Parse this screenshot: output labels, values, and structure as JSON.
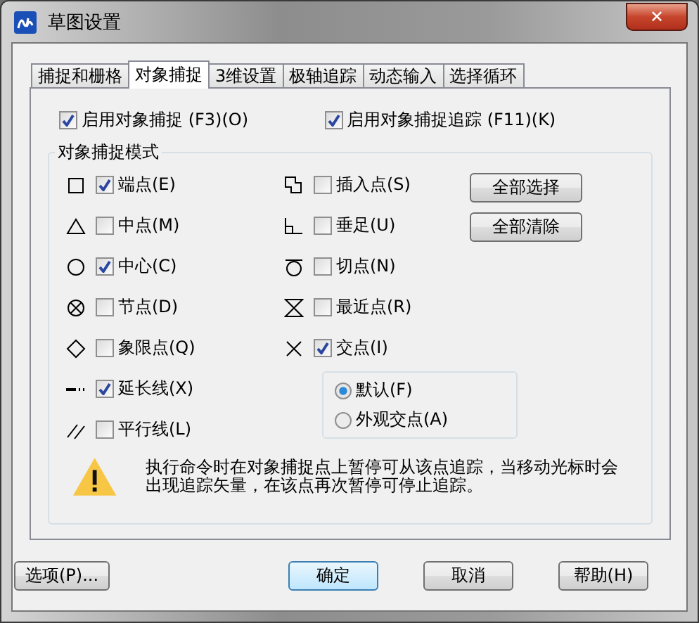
{
  "window": {
    "title": "草图设置",
    "close": "✕"
  },
  "tabs": [
    {
      "label": "捕捉和栅格",
      "selected": false
    },
    {
      "label": "对象捕捉",
      "selected": true
    },
    {
      "label": "3维设置",
      "selected": false
    },
    {
      "label": "极轴追踪",
      "selected": false
    },
    {
      "label": "动态输入",
      "selected": false
    },
    {
      "label": "选择循环",
      "selected": false
    }
  ],
  "enable_snap": {
    "label": "启用对象捕捉 (F3)(O)",
    "checked": true
  },
  "enable_tracking": {
    "label": "启用对象捕捉追踪 (F11)(K)",
    "checked": true
  },
  "modes_group": {
    "title": "对象捕捉模式",
    "left": [
      {
        "label": "端点(E)",
        "checked": true
      },
      {
        "label": "中点(M)",
        "checked": false
      },
      {
        "label": "中心(C)",
        "checked": true
      },
      {
        "label": "节点(D)",
        "checked": false
      },
      {
        "label": "象限点(Q)",
        "checked": false
      },
      {
        "label": "延长线(X)",
        "checked": true
      },
      {
        "label": "平行线(L)",
        "checked": false
      }
    ],
    "right": [
      {
        "label": "插入点(S)",
        "checked": false
      },
      {
        "label": "垂足(U)",
        "checked": false
      },
      {
        "label": "切点(N)",
        "checked": false
      },
      {
        "label": "最近点(R)",
        "checked": false
      },
      {
        "label": "交点(I)",
        "checked": true
      }
    ],
    "buttons": [
      "全部选择",
      "全部清除"
    ],
    "radios": [
      {
        "label": "默认(F)",
        "selected": true
      },
      {
        "label": "外观交点(A)",
        "selected": false
      }
    ],
    "note": "执行命令时在对象捕捉点上暂停可从该点追踪，当移动光标时会出现追踪矢量，在该点再次暂停可停止追踪。"
  },
  "footer": {
    "options": "选项(P)...",
    "ok": "确定",
    "cancel": "取消",
    "help": "帮助(H)"
  }
}
